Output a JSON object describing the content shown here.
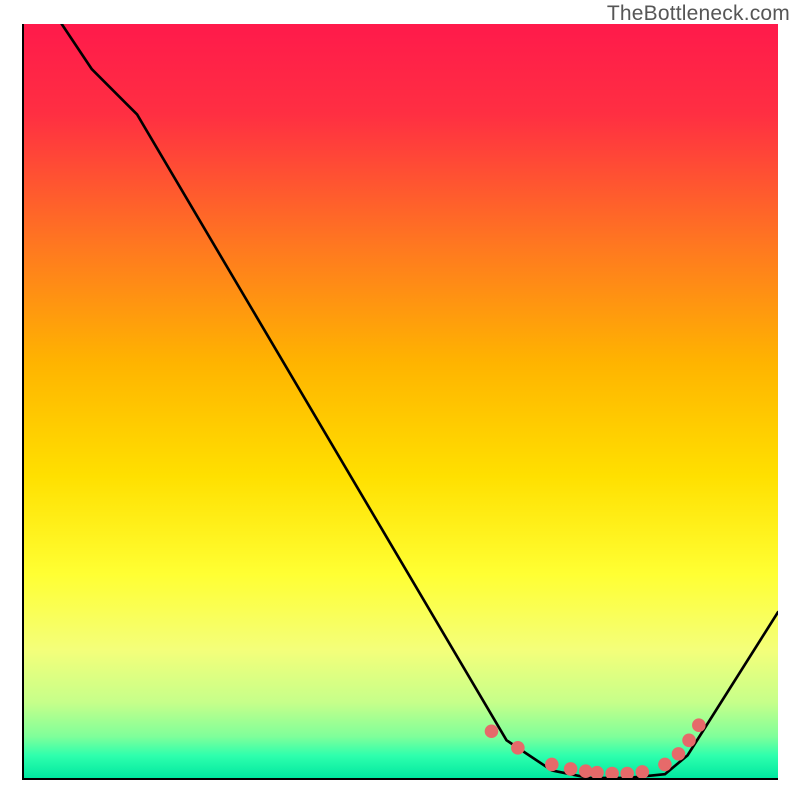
{
  "brand": "TheBottleneck.com",
  "chart_data": {
    "type": "line",
    "title": "",
    "xlabel": "",
    "ylabel": "",
    "xlim": [
      0,
      100
    ],
    "ylim": [
      0,
      100
    ],
    "gradient_stops": [
      {
        "offset": 0.0,
        "color": "#ff1a4b"
      },
      {
        "offset": 0.12,
        "color": "#ff2f42"
      },
      {
        "offset": 0.3,
        "color": "#ff7a1f"
      },
      {
        "offset": 0.45,
        "color": "#ffb400"
      },
      {
        "offset": 0.6,
        "color": "#ffe000"
      },
      {
        "offset": 0.73,
        "color": "#ffff33"
      },
      {
        "offset": 0.83,
        "color": "#f4ff7a"
      },
      {
        "offset": 0.9,
        "color": "#c6ff8a"
      },
      {
        "offset": 0.945,
        "color": "#7fff9a"
      },
      {
        "offset": 0.97,
        "color": "#2fffad"
      },
      {
        "offset": 1.0,
        "color": "#00e8a0"
      }
    ],
    "series": [
      {
        "name": "bottleneck-curve",
        "x": [
          5,
          9,
          15,
          64,
          70,
          75,
          80,
          85,
          88,
          100
        ],
        "y": [
          100,
          94,
          88,
          5,
          1,
          0,
          0,
          0.5,
          3,
          22
        ]
      }
    ],
    "markers": {
      "name": "highlight-dots",
      "color": "#e66a6a",
      "x": [
        62,
        65.5,
        70,
        72.5,
        74.5,
        76,
        78,
        80,
        82,
        85,
        86.8,
        88.2,
        89.5
      ],
      "y": [
        6.2,
        4.0,
        1.8,
        1.2,
        0.9,
        0.7,
        0.6,
        0.6,
        0.8,
        1.8,
        3.2,
        5.0,
        7.0
      ]
    }
  }
}
